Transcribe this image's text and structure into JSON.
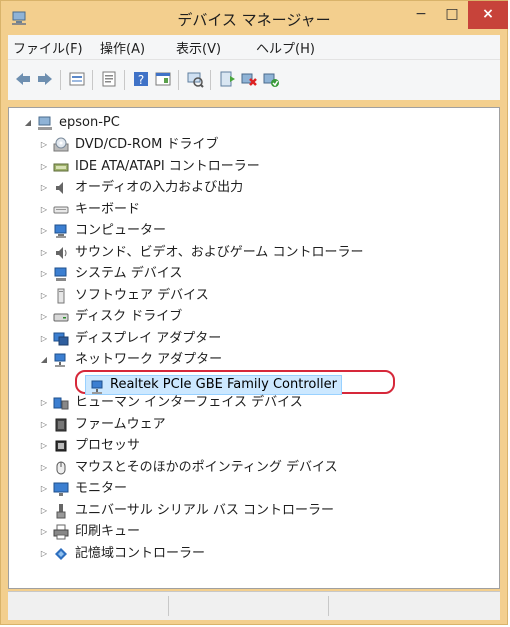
{
  "window": {
    "title": "デバイス マネージャー",
    "controls": {
      "minimize": "−",
      "maximize": "□",
      "close": "×"
    }
  },
  "menubar": {
    "items": [
      "ファイル(F)",
      "操作(A)",
      "表示(V)",
      "ヘルプ(H)"
    ]
  },
  "toolbar": {
    "icons": [
      "back-icon",
      "forward-icon",
      "properties-icon",
      "update-icon",
      "help-icon",
      "view-icon",
      "scan-icon",
      "driver-icon",
      "disable-icon",
      "enable-icon"
    ]
  },
  "tree": {
    "root": "epson-PC",
    "nodes": [
      {
        "label": "DVD/CD-ROM ドライブ",
        "icon": "dvd-icon",
        "expanded": false
      },
      {
        "label": "IDE ATA/ATAPI コントローラー",
        "icon": "ide-icon",
        "expanded": false
      },
      {
        "label": "オーディオの入力および出力",
        "icon": "speaker-icon",
        "expanded": false
      },
      {
        "label": "キーボード",
        "icon": "keyboard-icon",
        "expanded": false
      },
      {
        "label": "コンピューター",
        "icon": "computer-icon",
        "expanded": false
      },
      {
        "label": "サウンド、ビデオ、およびゲーム コントローラー",
        "icon": "sound-icon",
        "expanded": false
      },
      {
        "label": "システム デバイス",
        "icon": "system-icon",
        "expanded": false
      },
      {
        "label": "ソフトウェア デバイス",
        "icon": "software-icon",
        "expanded": false
      },
      {
        "label": "ディスク ドライブ",
        "icon": "disk-icon",
        "expanded": false
      },
      {
        "label": "ディスプレイ アダプター",
        "icon": "display-icon",
        "expanded": false
      },
      {
        "label": "ネットワーク アダプター",
        "icon": "network-icon",
        "expanded": true
      },
      {
        "label": "Realtek PCIe GBE Family Controller",
        "icon": "nic-icon",
        "child": true,
        "selected": true
      },
      {
        "label": "ヒューマン インターフェイス デバイス",
        "icon": "hid-icon",
        "expanded": false
      },
      {
        "label": "ファームウェア",
        "icon": "firmware-icon",
        "expanded": false
      },
      {
        "label": "プロセッサ",
        "icon": "processor-icon",
        "expanded": false
      },
      {
        "label": "マウスとそのほかのポインティング デバイス",
        "icon": "mouse-icon",
        "expanded": false
      },
      {
        "label": "モニター",
        "icon": "monitor-icon",
        "expanded": false
      },
      {
        "label": "ユニバーサル シリアル バス コントローラー",
        "icon": "usb-icon",
        "expanded": false
      },
      {
        "label": "印刷キュー",
        "icon": "printer-icon",
        "expanded": false
      },
      {
        "label": "記憶域コントローラー",
        "icon": "storage-icon",
        "expanded": false
      }
    ]
  },
  "colors": {
    "frame": "#f3cf8e",
    "close": "#c7433a",
    "highlight_ring": "#d6283a",
    "selection": "#cce8ff"
  }
}
